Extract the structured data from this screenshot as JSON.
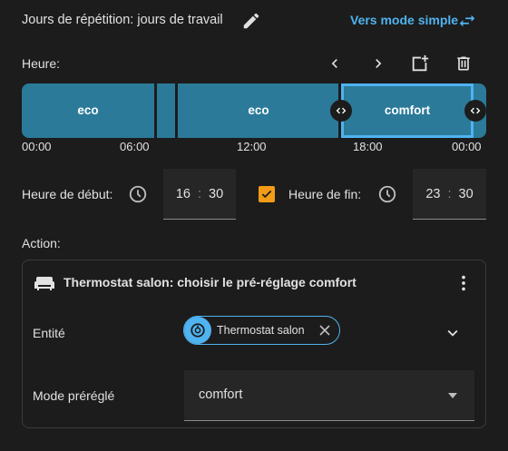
{
  "header": {
    "repeat_label": "Jours de répétition: jours de travail",
    "simple_mode_label": "Vers mode simple",
    "edit_icon": "pencil-icon",
    "swap_icon": "swap-horizontal-icon"
  },
  "hour": {
    "label": "Heure:",
    "tools": [
      "chevron-left-icon",
      "chevron-right-icon",
      "add-slot-icon",
      "delete-icon"
    ]
  },
  "timeline": {
    "segments": [
      {
        "label": "eco",
        "start": "00:00",
        "end": "08:00",
        "preset": "eco"
      },
      {
        "label": "eco",
        "start": "08:00",
        "end": "16:30",
        "preset": "eco"
      },
      {
        "label": "comfort",
        "start": "16:30",
        "end": "23:30",
        "preset": "comfort",
        "selected": true
      }
    ],
    "ticks": [
      "00:00",
      "06:00",
      "12:00",
      "18:00",
      "00:00"
    ],
    "color": "#2b7a99",
    "selected_color": "#4fb3f0"
  },
  "start": {
    "label": "Heure de début:",
    "hour": "16",
    "minute": "30",
    "separator": ":"
  },
  "end": {
    "label": "Heure de fin:",
    "hour": "23",
    "minute": "30",
    "separator": ":",
    "checked": true
  },
  "action": {
    "label": "Action:",
    "card_title": "Thermostat salon: choisir le pré-réglage comfort",
    "entity_label": "Entité",
    "entity_chip": "Thermostat salon",
    "mode_label": "Mode préréglé",
    "mode_value": "comfort"
  },
  "colors": {
    "background": "#1c1c1c",
    "accent": "#4fb3f0",
    "checkbox": "#f29b16"
  }
}
